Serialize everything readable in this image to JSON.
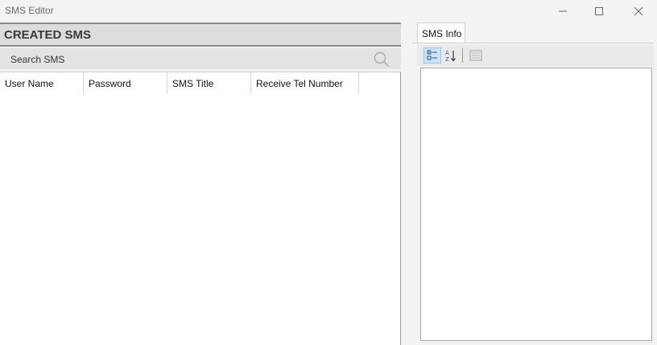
{
  "window": {
    "title": "SMS Editor",
    "controls": [
      "minimize-icon",
      "maximize-icon",
      "close-icon"
    ]
  },
  "left_panel": {
    "header": "CREATED SMS",
    "search": {
      "placeholder": "Search SMS",
      "icon": "search-icon"
    },
    "table": {
      "columns": [
        "User Name",
        "Password",
        "SMS Title",
        "Receive Tel Number"
      ],
      "rows": []
    }
  },
  "right_panel": {
    "tabs": [
      {
        "label": "SMS Info",
        "active": true
      }
    ],
    "toolbar": [
      "categorized-icon",
      "alphabetical-sort-icon",
      "property-pages-icon"
    ]
  },
  "colors": {
    "header_bg": "#dcdcdc",
    "search_bg": "#e3e3e3",
    "window_bg": "#f3f3f3",
    "selected_tool": "#cfe3f7"
  }
}
